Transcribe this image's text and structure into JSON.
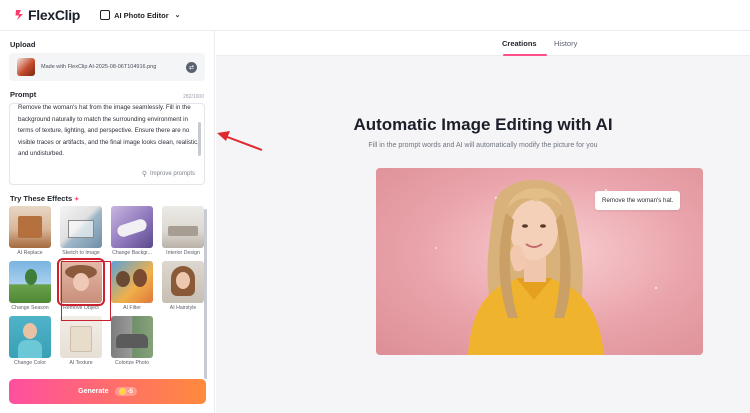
{
  "header": {
    "logo_text": "FlexClip",
    "tool_label": "AI Photo Editor"
  },
  "sidebar": {
    "upload_title": "Upload",
    "upload_filename": "Made with FlexClip AI-2025-08-06T104916.png",
    "prompt_title": "Prompt",
    "prompt_count": "282/1000",
    "prompt_text": "Remove the woman's hat from the image seamlessly. Fill in the background naturally to match the surrounding environment in terms of texture, lighting, and perspective. Ensure there are no visible traces or artifacts, and the final image looks clean, realistic, and undisturbed.",
    "improve_label": "Improve prompts",
    "effects_title": "Try These Effects",
    "effects": [
      {
        "label": "AI Replace"
      },
      {
        "label": "Sketch to Image"
      },
      {
        "label": "Change Backgr..."
      },
      {
        "label": "Interior Design"
      },
      {
        "label": "Change Season"
      },
      {
        "label": "Remove Object"
      },
      {
        "label": "AI Filter"
      },
      {
        "label": "AI Hairstyle"
      },
      {
        "label": "Change Color"
      },
      {
        "label": "AI Texture"
      },
      {
        "label": "Colorize Photo"
      }
    ],
    "selected_effect": "Remove Object",
    "generate_label": "Generate",
    "generate_cost": "-5"
  },
  "main": {
    "tabs": [
      {
        "label": "Creations",
        "active": true
      },
      {
        "label": "History",
        "active": false
      }
    ],
    "headline": "Automatic Image Editing with AI",
    "subline": "Fill in the prompt words and AI will automatically modify the picture for you",
    "bubble_text": "Remove the woman's hat."
  },
  "colors": {
    "accent_pink": "#ff4f8b",
    "generate_start": "#ff4fa0",
    "generate_end": "#ff8a3c",
    "selection_red": "#c8202f",
    "annotation_arrow": "#e0282f"
  }
}
